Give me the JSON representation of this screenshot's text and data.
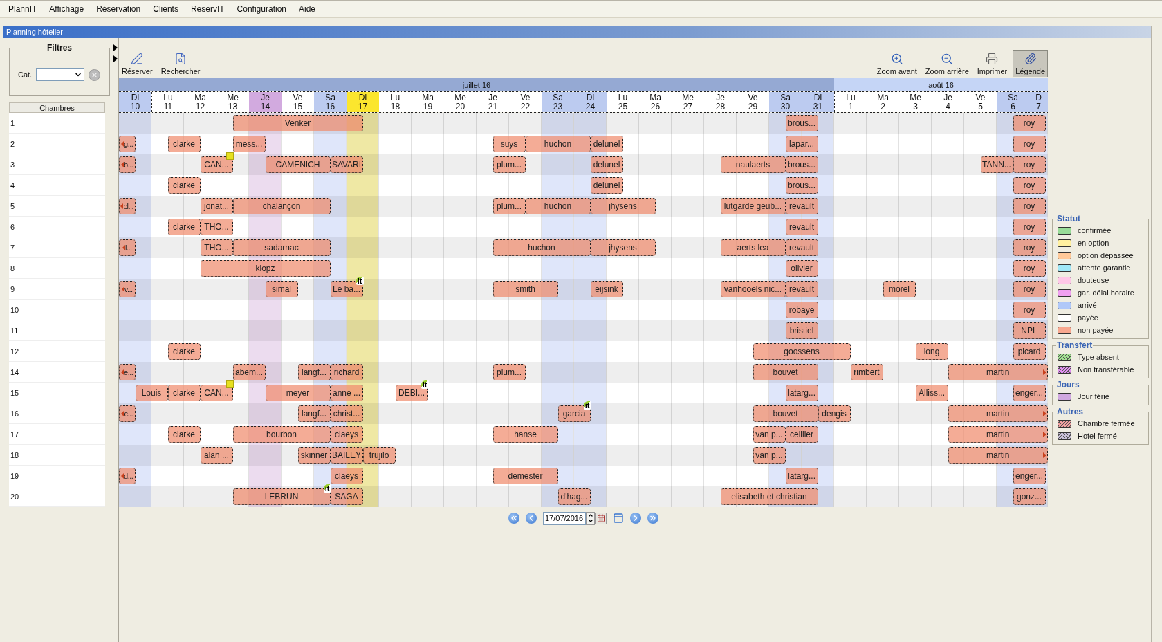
{
  "menu": [
    "PlannIT",
    "Affichage",
    "Réservation",
    "Clients",
    "ReservIT",
    "Configuration",
    "Aide"
  ],
  "window": {
    "title": "Planning hôtelier"
  },
  "filters": {
    "title": "Filtres",
    "category_label": "Cat."
  },
  "rooms_header": "Chambres",
  "toolbar_left": [
    {
      "kind": "reserve",
      "label": "Réserver",
      "selected": false
    },
    {
      "kind": "search",
      "label": "Rechercher",
      "selected": false
    }
  ],
  "toolbar_right": [
    {
      "kind": "zoom_in",
      "label": "Zoom avant",
      "selected": false
    },
    {
      "kind": "zoom_out",
      "label": "Zoom arrière",
      "selected": false
    },
    {
      "kind": "print",
      "label": "Imprimer",
      "selected": false
    },
    {
      "kind": "legend",
      "label": "Légende",
      "selected": true
    }
  ],
  "months": [
    {
      "label": "juillet 16",
      "kind": "current",
      "days": [
        {
          "weekday": "Di",
          "date": "10",
          "kind": "weekend"
        },
        {
          "weekday": "Lu",
          "date": "11",
          "kind": "weekday"
        },
        {
          "weekday": "Ma",
          "date": "12",
          "kind": "weekday"
        },
        {
          "weekday": "Me",
          "date": "13",
          "kind": "weekday"
        },
        {
          "weekday": "Je",
          "date": "14",
          "kind": "holiday"
        },
        {
          "weekday": "Ve",
          "date": "15",
          "kind": "weekday"
        },
        {
          "weekday": "Sa",
          "date": "16",
          "kind": "weekend"
        },
        {
          "weekday": "Di",
          "date": "17",
          "kind": "today"
        },
        {
          "weekday": "Lu",
          "date": "18",
          "kind": "weekday"
        },
        {
          "weekday": "Ma",
          "date": "19",
          "kind": "weekday"
        },
        {
          "weekday": "Me",
          "date": "20",
          "kind": "weekday"
        },
        {
          "weekday": "Je",
          "date": "21",
          "kind": "weekday"
        },
        {
          "weekday": "Ve",
          "date": "22",
          "kind": "weekday"
        },
        {
          "weekday": "Sa",
          "date": "23",
          "kind": "weekend"
        },
        {
          "weekday": "Di",
          "date": "24",
          "kind": "weekend"
        },
        {
          "weekday": "Lu",
          "date": "25",
          "kind": "weekday"
        },
        {
          "weekday": "Ma",
          "date": "26",
          "kind": "weekday"
        },
        {
          "weekday": "Me",
          "date": "27",
          "kind": "weekday"
        },
        {
          "weekday": "Je",
          "date": "28",
          "kind": "weekday"
        },
        {
          "weekday": "Ve",
          "date": "29",
          "kind": "weekday"
        },
        {
          "weekday": "Sa",
          "date": "30",
          "kind": "weekend"
        },
        {
          "weekday": "Di",
          "date": "31",
          "kind": "weekend"
        }
      ]
    },
    {
      "label": "août 16",
      "kind": "next",
      "days": [
        {
          "weekday": "Lu",
          "date": "1",
          "kind": "weekday"
        },
        {
          "weekday": "Ma",
          "date": "2",
          "kind": "weekday"
        },
        {
          "weekday": "Me",
          "date": "3",
          "kind": "weekday"
        },
        {
          "weekday": "Je",
          "date": "4",
          "kind": "weekday"
        },
        {
          "weekday": "Ve",
          "date": "5",
          "kind": "weekday"
        },
        {
          "weekday": "Sa",
          "date": "6",
          "kind": "weekend"
        },
        {
          "weekday": "D",
          "date": "7",
          "kind": "weekend"
        }
      ]
    }
  ],
  "rooms": [
    {
      "number": "1",
      "bookings": [
        {
          "guest": "Venker"
        },
        {
          "guest": "brous..."
        },
        {
          "guest": "roy"
        }
      ]
    },
    {
      "number": "2",
      "bookings": [
        {
          "guest": "g..."
        },
        {
          "guest": "clarke"
        },
        {
          "guest": "mess..."
        },
        {
          "guest": "suys"
        },
        {
          "guest": "huchon"
        },
        {
          "guest": "delunel"
        },
        {
          "guest": "lapar..."
        },
        {
          "guest": "roy"
        }
      ]
    },
    {
      "number": "3",
      "bookings": [
        {
          "guest": "b..."
        },
        {
          "guest": "CAN...",
          "badge": {
            "kind": "stage"
          }
        },
        {
          "guest": "CAMENICH"
        },
        {
          "guest": "SAVARI"
        },
        {
          "guest": "plum..."
        },
        {
          "guest": "delunel"
        },
        {
          "guest": "naulaerts"
        },
        {
          "guest": "brous..."
        },
        {
          "guest": "TANN..."
        },
        {
          "guest": "roy"
        }
      ]
    },
    {
      "number": "4",
      "bookings": [
        {
          "guest": "clarke"
        },
        {
          "guest": "delunel"
        },
        {
          "guest": "brous..."
        },
        {
          "guest": "roy"
        }
      ]
    },
    {
      "number": "5",
      "bookings": [
        {
          "guest": "cl..."
        },
        {
          "guest": "jonat..."
        },
        {
          "guest": "chalançon"
        },
        {
          "guest": "plum..."
        },
        {
          "guest": "huchon"
        },
        {
          "guest": "jhysens"
        },
        {
          "guest": "lutgarde geub..."
        },
        {
          "guest": "revault"
        },
        {
          "guest": "roy"
        }
      ]
    },
    {
      "number": "6",
      "bookings": [
        {
          "guest": "clarke"
        },
        {
          "guest": "THO..."
        },
        {
          "guest": "revault"
        },
        {
          "guest": "roy"
        }
      ]
    },
    {
      "number": "7",
      "bookings": [
        {
          "guest": "l..."
        },
        {
          "guest": "THO..."
        },
        {
          "guest": "sadarnac"
        },
        {
          "guest": "huchon"
        },
        {
          "guest": "jhysens"
        },
        {
          "guest": "aerts lea"
        },
        {
          "guest": "revault"
        },
        {
          "guest": "roy"
        }
      ]
    },
    {
      "number": "8",
      "bookings": [
        {
          "guest": "klopz"
        },
        {
          "guest": "olivier"
        },
        {
          "guest": "roy"
        }
      ]
    },
    {
      "number": "9",
      "bookings": [
        {
          "guest": "v..."
        },
        {
          "guest": "simal"
        },
        {
          "guest": "Le ba...",
          "badge": {
            "kind": "logo",
            "text": "it"
          }
        },
        {
          "guest": "smith"
        },
        {
          "guest": "eijsink"
        },
        {
          "guest": "vanhooels nic..."
        },
        {
          "guest": "revault"
        },
        {
          "guest": "morel"
        },
        {
          "guest": "roy"
        }
      ]
    },
    {
      "number": "10",
      "bookings": [
        {
          "guest": "robaye"
        },
        {
          "guest": "roy"
        }
      ]
    },
    {
      "number": "11",
      "bookings": [
        {
          "guest": "bristiel"
        },
        {
          "guest": "NPL"
        }
      ]
    },
    {
      "number": "12",
      "bookings": [
        {
          "guest": "clarke"
        },
        {
          "guest": "goossens"
        },
        {
          "guest": "long"
        },
        {
          "guest": "picard"
        }
      ]
    },
    {
      "number": "14",
      "bookings": [
        {
          "guest": "e..."
        },
        {
          "guest": "abem..."
        },
        {
          "guest": "langf..."
        },
        {
          "guest": "richard"
        },
        {
          "guest": "plum..."
        },
        {
          "guest": "bouvet"
        },
        {
          "guest": "rimbert"
        },
        {
          "guest": "martin"
        }
      ]
    },
    {
      "number": "15",
      "bookings": [
        {
          "guest": "Louis"
        },
        {
          "guest": "clarke"
        },
        {
          "guest": "CAN...",
          "badge": {
            "kind": "stage"
          }
        },
        {
          "guest": "meyer"
        },
        {
          "guest": "anne ..."
        },
        {
          "guest": "DEBI...",
          "badge": {
            "kind": "logo",
            "text": "it"
          }
        },
        {
          "guest": "latarg..."
        },
        {
          "guest": "Alliss..."
        },
        {
          "guest": "enger..."
        }
      ]
    },
    {
      "number": "16",
      "bookings": [
        {
          "guest": "c..."
        },
        {
          "guest": "langf..."
        },
        {
          "guest": "christ..."
        },
        {
          "guest": "garcia",
          "badge": {
            "kind": "logo",
            "text": "it"
          }
        },
        {
          "guest": "bouvet"
        },
        {
          "guest": "dengis"
        },
        {
          "guest": "martin"
        }
      ]
    },
    {
      "number": "17",
      "bookings": [
        {
          "guest": "clarke"
        },
        {
          "guest": "bourbon"
        },
        {
          "guest": "claeys"
        },
        {
          "guest": "hanse"
        },
        {
          "guest": "van p..."
        },
        {
          "guest": "ceillier"
        },
        {
          "guest": "martin"
        }
      ]
    },
    {
      "number": "18",
      "bookings": [
        {
          "guest": "alan ..."
        },
        {
          "guest": "skinner"
        },
        {
          "guest": "BAILEY"
        },
        {
          "guest": "trujilo"
        },
        {
          "guest": "van p..."
        },
        {
          "guest": "martin"
        }
      ]
    },
    {
      "number": "19",
      "bookings": [
        {
          "guest": "d..."
        },
        {
          "guest": "claeys"
        },
        {
          "guest": "demester"
        },
        {
          "guest": "latarg..."
        },
        {
          "guest": "enger..."
        }
      ]
    },
    {
      "number": "20",
      "bookings": [
        {
          "guest": "LEBRUN",
          "badge": {
            "kind": "logo",
            "text": "it"
          }
        },
        {
          "guest": "SAGA"
        },
        {
          "guest": "d'hag..."
        },
        {
          "guest": "elisabeth et christian"
        },
        {
          "guest": "gonz..."
        }
      ]
    }
  ],
  "navigation": {
    "date": "17/07/2016"
  },
  "legend": [
    {
      "title": "Statut",
      "items": [
        {
          "label": "confirmée",
          "color": "#98dc98",
          "kind": "solid"
        },
        {
          "label": "en option",
          "color": "#fff0a0",
          "kind": "solid"
        },
        {
          "label": "option dépassée",
          "color": "#ffc898",
          "kind": "solid"
        },
        {
          "label": "attente garantie",
          "color": "#a0e8f8",
          "kind": "solid"
        },
        {
          "label": "douteuse",
          "color": "#ffc8e8",
          "kind": "solid"
        },
        {
          "label": "gar. délai horaire",
          "color": "#f0a0f0",
          "kind": "solid"
        },
        {
          "label": "arrivé",
          "color": "#b0c8f8",
          "kind": "solid"
        },
        {
          "label": "payée",
          "color": "#ffffff",
          "kind": "solid"
        },
        {
          "label": "non payée",
          "color": "#f8a890",
          "kind": "solid"
        }
      ]
    },
    {
      "title": "Transfert",
      "items": [
        {
          "label": "Type absent",
          "color": "#a0e090",
          "kind": "hatched"
        },
        {
          "label": "Non transférable",
          "color": "#e090f0",
          "kind": "hatched"
        }
      ]
    },
    {
      "title": "Jours",
      "items": [
        {
          "label": "Jour férié",
          "color": "#d0a8e0",
          "kind": "solid"
        }
      ]
    },
    {
      "title": "Autres",
      "items": [
        {
          "label": "Chambre fermée",
          "color": "#f0a0a0",
          "kind": "hatched"
        },
        {
          "label": "Hotel fermé",
          "color": "#c8c0d8",
          "kind": "hatched"
        }
      ]
    }
  ]
}
